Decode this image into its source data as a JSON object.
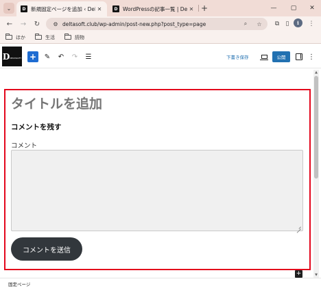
{
  "browser": {
    "tabs": [
      {
        "title": "新規固定ページを追加 ‹ DeltaSoft",
        "favicon": "D",
        "active": true
      },
      {
        "title": "WordPressの記事一覧 | DeltaSo",
        "favicon": "D",
        "active": false
      }
    ],
    "url": "deltasoft.club/wp-admin/post-new.php?post_type=page",
    "profile_initial": "i",
    "bookmarks": [
      {
        "label": "ほか",
        "icon": "folder-icon"
      },
      {
        "label": "生活",
        "icon": "folder-icon"
      },
      {
        "label": "読物",
        "icon": "folder-icon"
      }
    ]
  },
  "editor": {
    "logo_letter": "D",
    "logo_small": "DELTASOFT",
    "save_draft_label": "下書き保存",
    "publish_label": "公開",
    "title_placeholder": "タイトルを追加",
    "section_heading": "コメントを残す",
    "comment_label": "コメント",
    "submit_label": "コメントを送信",
    "breadcrumb": "固定ページ"
  },
  "colors": {
    "accent": "#2271b1",
    "inserter": "#1e6cd2",
    "highlight": "#e3051b",
    "submit_button": "#32373c"
  }
}
